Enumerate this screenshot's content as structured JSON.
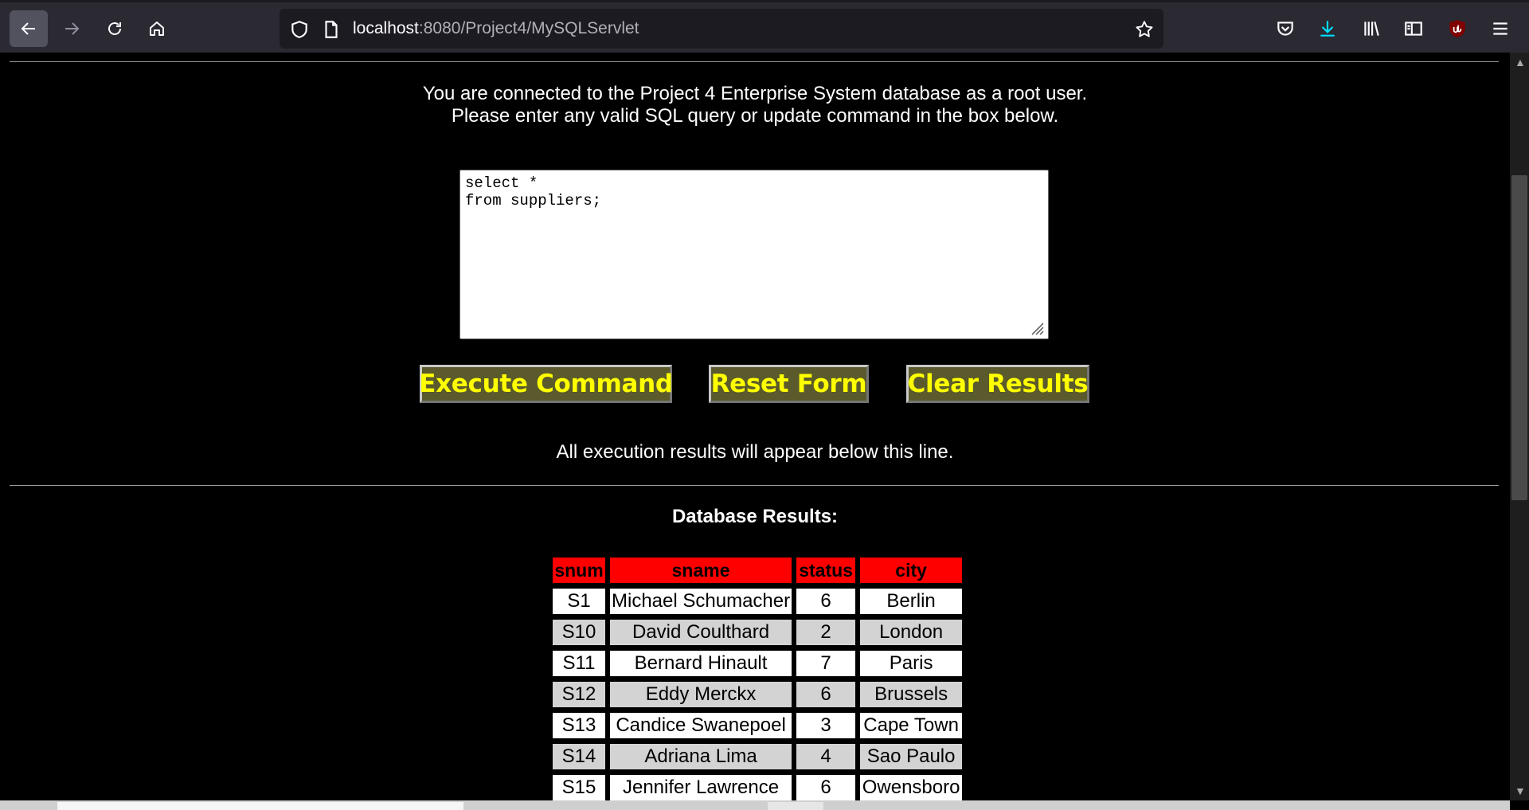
{
  "browser": {
    "url_host": "localhost",
    "url_rest": ":8080/Project4/MySQLServlet"
  },
  "page": {
    "intro_line1": "You are connected to the Project 4 Enterprise System database as a root user.",
    "intro_line2": "Please enter any valid SQL query or update command in the box below.",
    "query_text": "select *\nfrom suppliers;",
    "buttons": {
      "execute": "Execute Command",
      "reset": "Reset Form",
      "clear": "Clear Results"
    },
    "results_note": "All execution results will appear below this line.",
    "results_title": "Database Results:"
  },
  "results": {
    "columns": [
      "snum",
      "sname",
      "status",
      "city"
    ],
    "rows": [
      [
        "S1",
        "Michael Schumacher",
        "6",
        "Berlin"
      ],
      [
        "S10",
        "David Coulthard",
        "2",
        "London"
      ],
      [
        "S11",
        "Bernard Hinault",
        "7",
        "Paris"
      ],
      [
        "S12",
        "Eddy Merckx",
        "6",
        "Brussels"
      ],
      [
        "S13",
        "Candice Swanepoel",
        "3",
        "Cape Town"
      ],
      [
        "S14",
        "Adriana Lima",
        "4",
        "Sao Paulo"
      ],
      [
        "S15",
        "Jennifer Lawrence",
        "6",
        "Owensboro"
      ],
      [
        "",
        "",
        "",
        ""
      ]
    ]
  },
  "colors": {
    "header_bg": "#ff0000",
    "button_bg": "#5a5a2c",
    "button_text": "#ffff00",
    "row_odd": "#ffffff",
    "row_even": "#d3d3d3"
  }
}
